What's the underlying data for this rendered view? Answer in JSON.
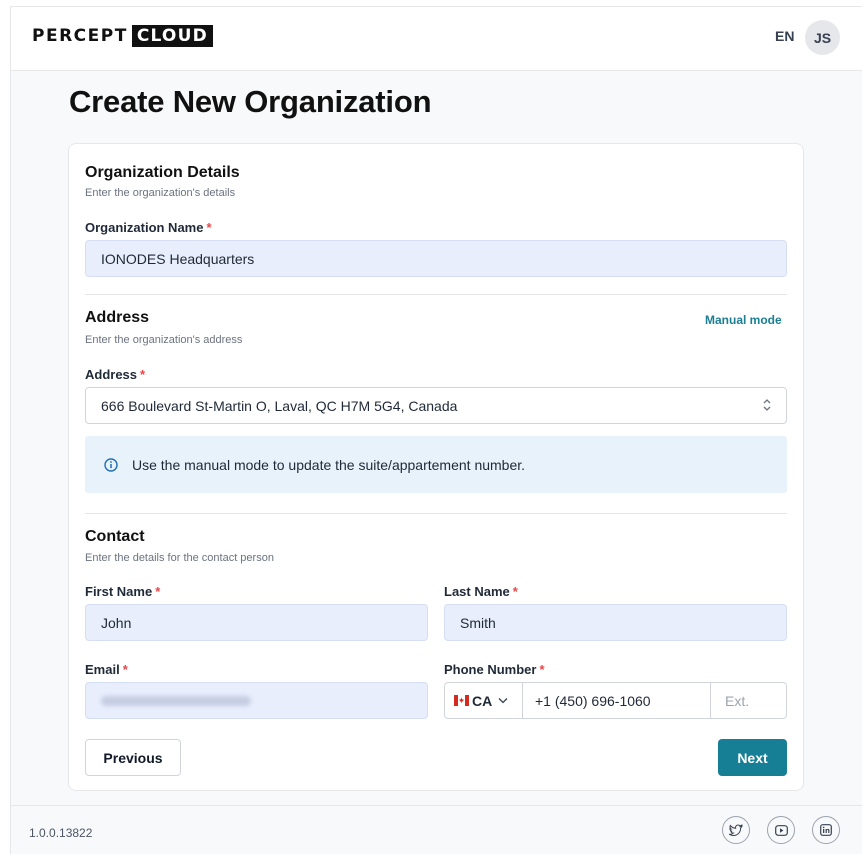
{
  "header": {
    "logo_part1": "PERCEPT",
    "logo_part2": "CLOUD",
    "language": "EN",
    "user_initials": "JS"
  },
  "page": {
    "title": "Create New Organization"
  },
  "organization": {
    "title": "Organization Details",
    "subtitle": "Enter the organization's details",
    "name_label": "Organization Name",
    "name_value": "IONODES Headquarters"
  },
  "address": {
    "title": "Address",
    "subtitle": "Enter the organization's address",
    "manual_mode_link": "Manual mode",
    "field_label": "Address",
    "field_value": "666 Boulevard St-Martin O, Laval, QC H7M 5G4, Canada",
    "info_text": "Use the manual mode to update the suite/appartement number."
  },
  "contact": {
    "title": "Contact",
    "subtitle": "Enter the details for the contact person",
    "first_name_label": "First Name",
    "first_name_value": "John",
    "last_name_label": "Last Name",
    "last_name_value": "Smith",
    "email_label": "Email",
    "phone_label": "Phone Number",
    "phone_country": "CA",
    "phone_number": "+1 (450) 696-1060",
    "phone_ext_placeholder": "Ext."
  },
  "required_marker": "*",
  "buttons": {
    "previous": "Previous",
    "next": "Next"
  },
  "footer": {
    "version": "1.0.0.13822",
    "social_icons": [
      "twitter-icon",
      "youtube-icon",
      "linkedin-icon"
    ]
  },
  "colors": {
    "accent": "#177f95",
    "link": "#1a7f93",
    "input_background": "#e8eefc",
    "info_background": "#e8f2fb",
    "required": "#ef4444"
  }
}
